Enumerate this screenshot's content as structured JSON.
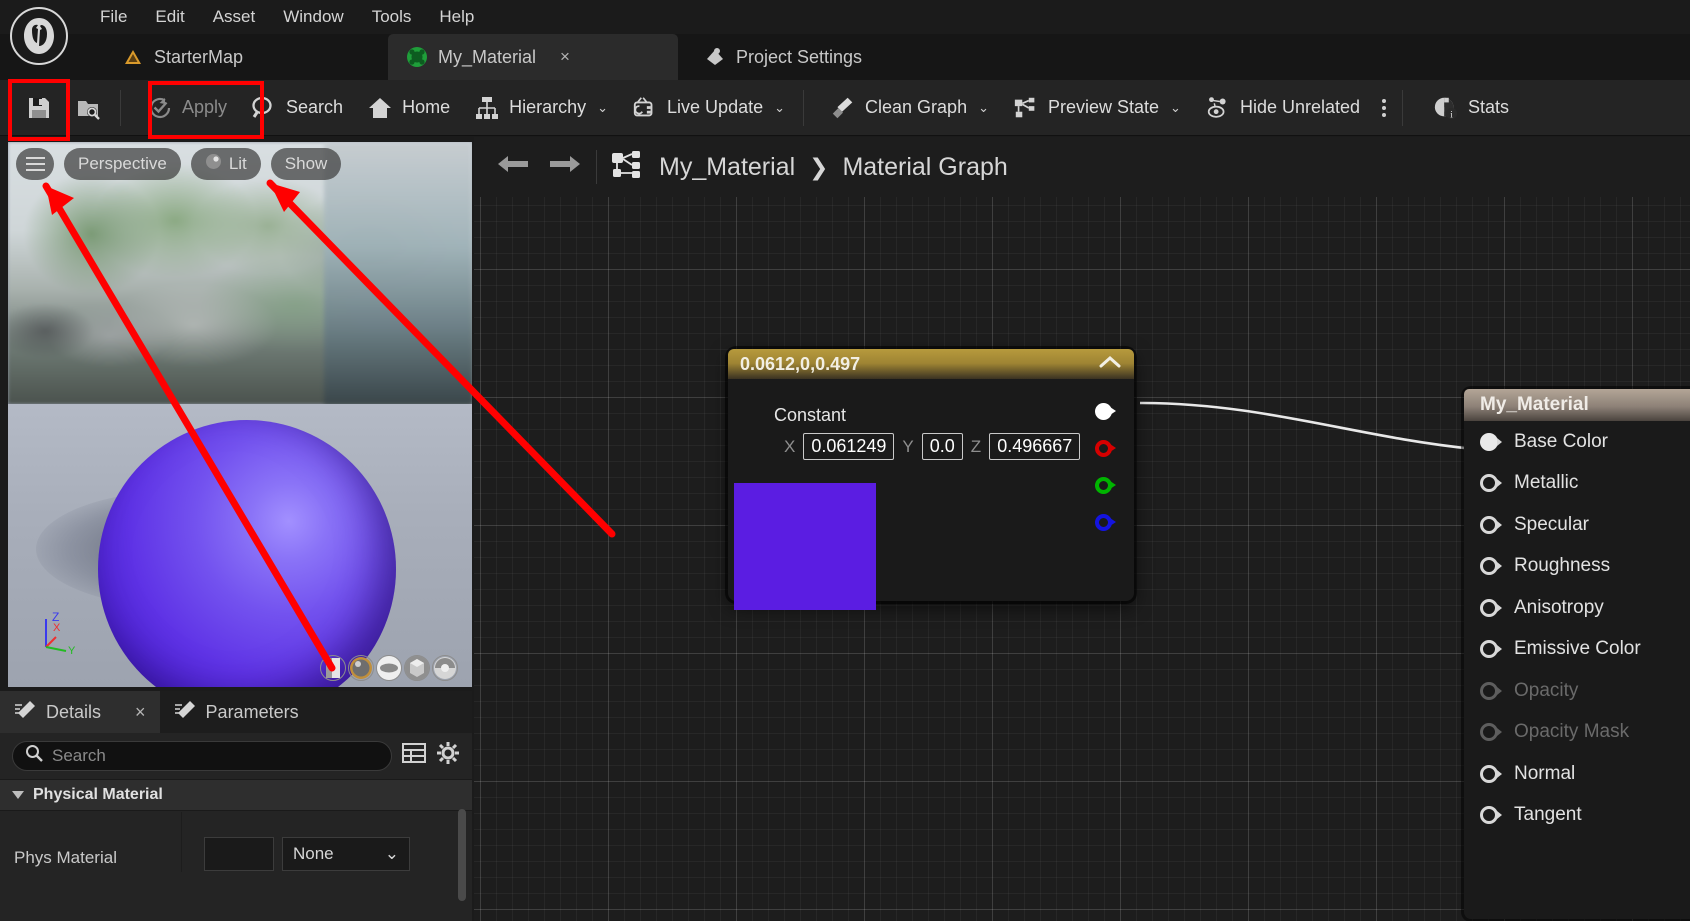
{
  "app": {
    "logo_icon": "unreal-engine-logo"
  },
  "menubar": {
    "items": [
      {
        "label": "File"
      },
      {
        "label": "Edit"
      },
      {
        "label": "Asset"
      },
      {
        "label": "Window"
      },
      {
        "label": "Tools"
      },
      {
        "label": "Help"
      }
    ]
  },
  "tabs": [
    {
      "label": "StarterMap",
      "icon": "level-icon",
      "active": false,
      "closable": false
    },
    {
      "label": "My_Material",
      "icon": "material-sphere-icon",
      "active": true,
      "closable": true,
      "close_label": "×"
    },
    {
      "label": "Project Settings",
      "icon": "settings-gear-icon",
      "active": false,
      "closable": false
    }
  ],
  "toolbar": {
    "save_label": "",
    "save_icon": "save-floppy-icon",
    "browse_icon": "find-in-content-browser-icon",
    "apply_label": "Apply",
    "apply_icon": "apply-check-icon",
    "apply_enabled": false,
    "search_label": "Search",
    "search_icon": "magnifier-icon",
    "home_label": "Home",
    "home_icon": "home-icon",
    "hierarchy_label": "Hierarchy",
    "hierarchy_icon": "hierarchy-icon",
    "live_update_label": "Live Update",
    "live_update_icon": "live-update-icon",
    "clean_graph_label": "Clean Graph",
    "clean_graph_icon": "broom-icon",
    "preview_state_label": "Preview State",
    "preview_state_icon": "preview-state-icon",
    "hide_unrelated_label": "Hide Unrelated",
    "hide_unrelated_icon": "hide-unrelated-icon",
    "overflow_icon": "kebab-menu-icon",
    "stats_label": "Stats",
    "stats_icon": "stats-icon",
    "caret": "⌄"
  },
  "viewport": {
    "menu_icon": "viewport-menu-icon",
    "perspective_label": "Perspective",
    "lighting_label": "Lit",
    "lighting_icon": "lit-sphere-icon",
    "show_label": "Show",
    "gizmo_axes": [
      "Z",
      "X",
      "Y"
    ],
    "preview_shapes": [
      "cylinder-shape",
      "sphere-shape",
      "plane-shape",
      "cube-shape",
      "custom-mesh-shape"
    ],
    "sphere_color": "#5b1de2"
  },
  "details_panel": {
    "tabs": [
      {
        "label": "Details",
        "icon": "details-pencil-icon",
        "active": true,
        "closable": true,
        "close_label": "×"
      },
      {
        "label": "Parameters",
        "icon": "parameters-pencil-icon",
        "active": false,
        "closable": false
      }
    ],
    "search_placeholder": "Search",
    "search_value": "",
    "search_icon": "search-magnifier-icon",
    "column_view_icon": "column-view-icon",
    "settings_icon": "settings-gear-icon",
    "section_label": "Physical Material",
    "row_label": "Phys Material",
    "row_value": "None",
    "row_caret": "⌄"
  },
  "graph": {
    "back_icon": "back-arrow-icon",
    "forward_icon": "forward-arrow-icon",
    "graph_icon": "material-graph-icon",
    "breadcrumb": [
      "My_Material",
      "Material Graph"
    ],
    "breadcrumb_separator": "❯"
  },
  "constant_node": {
    "title": "0.0612,0,0.497",
    "collapse_icon": "chevron-up-icon",
    "constant_label": "Constant",
    "fields": [
      {
        "axis": "X",
        "value": "0.061249"
      },
      {
        "axis": "Y",
        "value": "0.0"
      },
      {
        "axis": "Z",
        "value": "0.496667"
      }
    ],
    "preview_color": "#5b1de2",
    "output_pins": [
      {
        "name": "rgb-output-pin",
        "color": "#ffffff",
        "connected": true
      },
      {
        "name": "r-output-pin",
        "color": "#d60000",
        "connected": false
      },
      {
        "name": "g-output-pin",
        "color": "#00b400",
        "connected": false
      },
      {
        "name": "b-output-pin",
        "color": "#1414e0",
        "connected": false
      }
    ]
  },
  "material_node": {
    "title": "My_Material",
    "inputs": [
      {
        "label": "Base Color",
        "connected": true,
        "enabled": true
      },
      {
        "label": "Metallic",
        "connected": false,
        "enabled": true
      },
      {
        "label": "Specular",
        "connected": false,
        "enabled": true
      },
      {
        "label": "Roughness",
        "connected": false,
        "enabled": true
      },
      {
        "label": "Anisotropy",
        "connected": false,
        "enabled": true
      },
      {
        "label": "Emissive Color",
        "connected": false,
        "enabled": true
      },
      {
        "label": "Opacity",
        "connected": false,
        "enabled": false
      },
      {
        "label": "Opacity Mask",
        "connected": false,
        "enabled": false
      },
      {
        "label": "Normal",
        "connected": false,
        "enabled": true
      },
      {
        "label": "Tangent",
        "connected": false,
        "enabled": true
      }
    ]
  },
  "annotations": {
    "highlight_color": "#ff0000",
    "boxes": [
      "save-button-highlight",
      "apply-button-highlight"
    ],
    "arrows": [
      "arrow-to-viewport-menu",
      "arrow-to-show-menu"
    ]
  }
}
